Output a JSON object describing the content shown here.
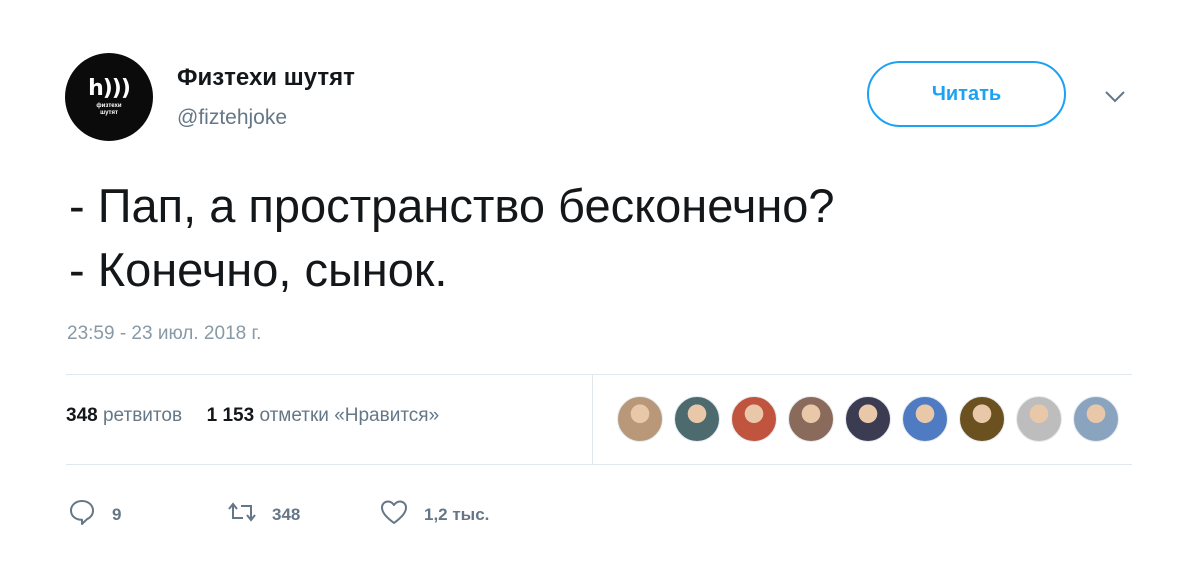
{
  "account": {
    "name": "Физтехи шутят",
    "handle": "@fiztehjoke",
    "avatar_mark": "h)))",
    "avatar_text_line1": "физтехи",
    "avatar_text_line2": "шутят"
  },
  "follow_button": {
    "label": "Читать",
    "color": "#1da1f2"
  },
  "tweet": {
    "line1": "- Пап, а пространство бесконечно?",
    "line2": "- Конечно, сынок.",
    "timestamp": "23:59 - 23 июл. 2018 г."
  },
  "stats": {
    "retweets_count": "348",
    "retweets_label": "ретвитов",
    "likes_count": "1 153",
    "likes_label": "отметки «Нравится»"
  },
  "likers": [
    {
      "color": "#b89878"
    },
    {
      "color": "#4d6a6e"
    },
    {
      "color": "#c0543f"
    },
    {
      "color": "#8a6a5a"
    },
    {
      "color": "#3b3b52"
    },
    {
      "color": "#4f7bc2"
    },
    {
      "color": "#6b5020"
    },
    {
      "color": "#bdbdbd"
    },
    {
      "color": "#8aa4bf"
    }
  ],
  "actions": {
    "replies": "9",
    "retweets": "348",
    "likes": "1,2 тыс."
  },
  "icons": [
    "caret-down-icon",
    "reply-icon",
    "retweet-icon",
    "heart-icon"
  ]
}
